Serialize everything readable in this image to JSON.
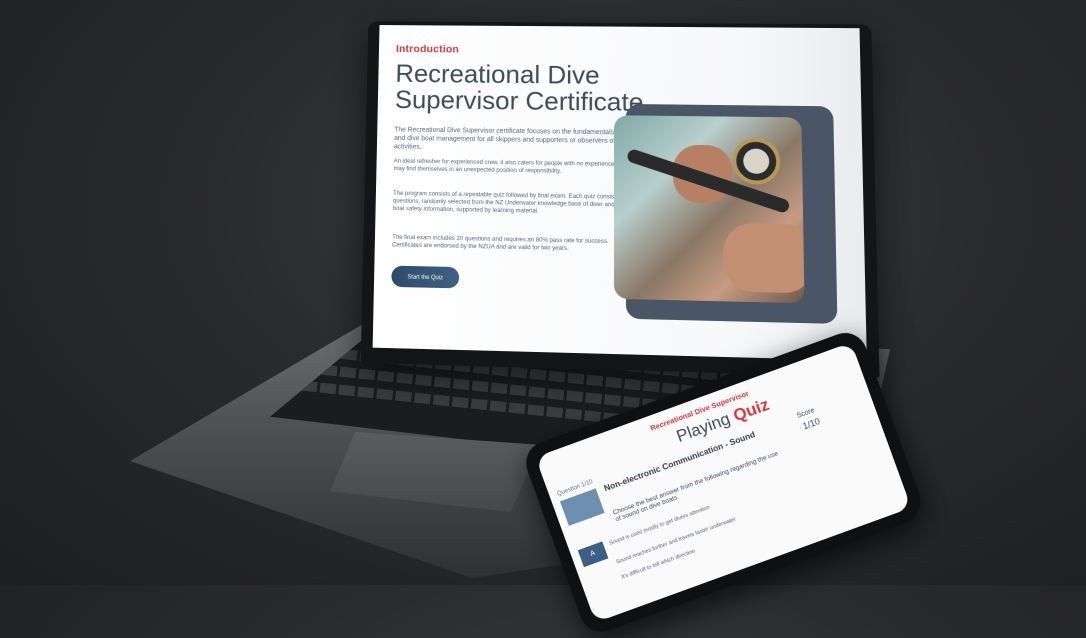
{
  "laptop_page": {
    "section_label": "Introduction",
    "title": "Recreational Dive Supervisor Certificate",
    "paragraphs": [
      "The Recreational Dive Supervisor certificate focuses on the fundamentals of diver and dive boat management for all skippers and supporters or observers of dive activities.",
      "An ideal refresher for experienced crew, it also caters for people with no experience who may find themselves in an unexpected position of responsibility.",
      "The program consists of a repeatable quiz followed by final exam. Each quiz consists of 10 questions, randomly selected from the NZ Underwater knowledge base of diver and dive boat safety information, supported by learning material.",
      "The final exam includes 20 questions and requires an 80% pass rate for success. Certificates are endorsed by the NZUA and are valid for two years."
    ],
    "cta_label": "Start the Quiz",
    "photo_icon": "dive-regulator-photo"
  },
  "phone_page": {
    "section_label": "Recreational Dive Supervisor",
    "title_prefix": "Playing",
    "title_accent": "Quiz",
    "question_label": "Question 1/10",
    "category": "Non-electronic Communication - Sound",
    "score_label": "Score",
    "score_value": "1/10",
    "question_text": "Choose the best answer from the following regarding the use of sound on dive boats.",
    "option_letter": "A",
    "options": [
      "Sound is used mostly to get divers attention",
      "Sound reaches further and travels faster underwater",
      "It's difficult to tell which direction"
    ]
  },
  "colors": {
    "accent_red": "#d9363e",
    "heading_slate": "#3f4a5a",
    "button_blue": "#3f6185"
  }
}
